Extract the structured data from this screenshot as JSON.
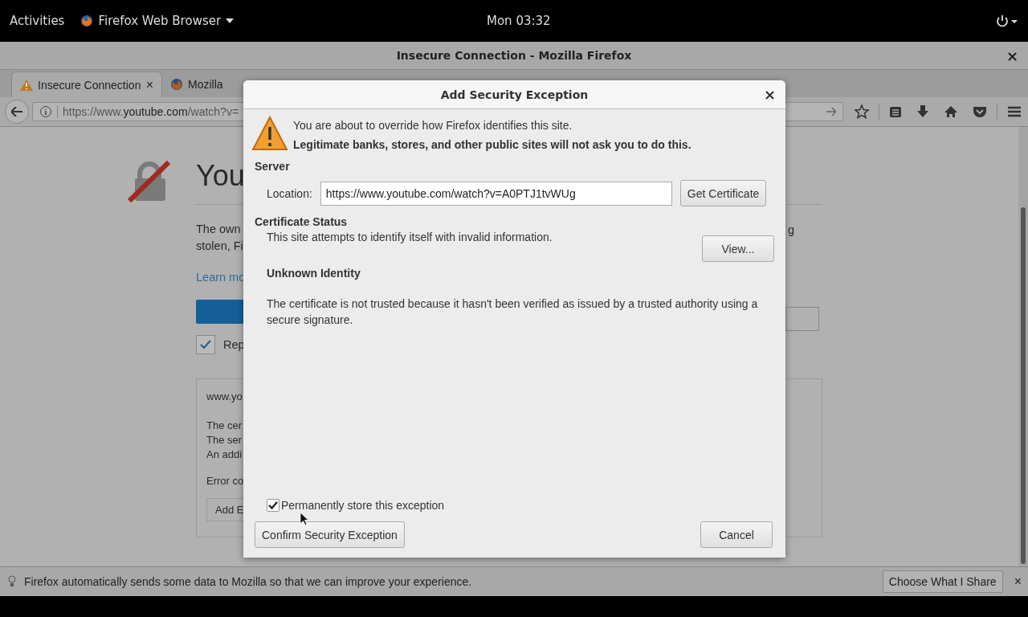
{
  "top_bar": {
    "activities": "Activities",
    "app_menu": "Firefox Web Browser",
    "clock": "Mon 03:32"
  },
  "window": {
    "title": "Insecure Connection - Mozilla Firefox",
    "close": "×"
  },
  "tabs": [
    {
      "label": "Insecure Connection",
      "selected": true,
      "kind": "warning",
      "close": "×"
    },
    {
      "label": "Mozilla",
      "selected": false,
      "kind": "firefox"
    }
  ],
  "address_bar": {
    "prefix": "https://www.",
    "domain": "youtube.com",
    "suffix": "/watch?v="
  },
  "page": {
    "heading": "You",
    "paragraph_lines": [
      "The own",
      "stolen, Fi"
    ],
    "fragment": "g",
    "link": "Learn mo",
    "report": {
      "label": "Rep",
      "checked": true
    },
    "details": {
      "host": "www.yo",
      "lines": [
        "The cer",
        "The ser",
        "An addi"
      ],
      "error_code": "Error co",
      "button": "Add E"
    }
  },
  "dialog": {
    "title": "Add Security Exception",
    "close": "×",
    "warning": "You are about to override how Firefox identifies this site.",
    "warning_bold": "Legitimate banks, stores, and other public sites will not ask you to do this.",
    "server_heading": "Server",
    "location_label": "Location:",
    "location_value": "https://www.youtube.com/watch?v=A0PTJ1tvWUg",
    "get_certificate": "Get Certificate",
    "status_heading": "Certificate Status",
    "status_text": "This site attempts to identify itself with invalid information.",
    "view_button": "View...",
    "identity_heading": "Unknown Identity",
    "identity_text": "The certificate is not trusted because it hasn't been verified as issued by a trusted authority using a secure signature.",
    "permanent": {
      "label": "Permanently store this exception",
      "checked": true
    },
    "confirm_button": "Confirm Security Exception",
    "cancel_button": "Cancel"
  },
  "notification": {
    "text": "Firefox automatically sends some data to Mozilla so that we can improve your experience.",
    "button": "Choose What I Share",
    "close": "×"
  }
}
